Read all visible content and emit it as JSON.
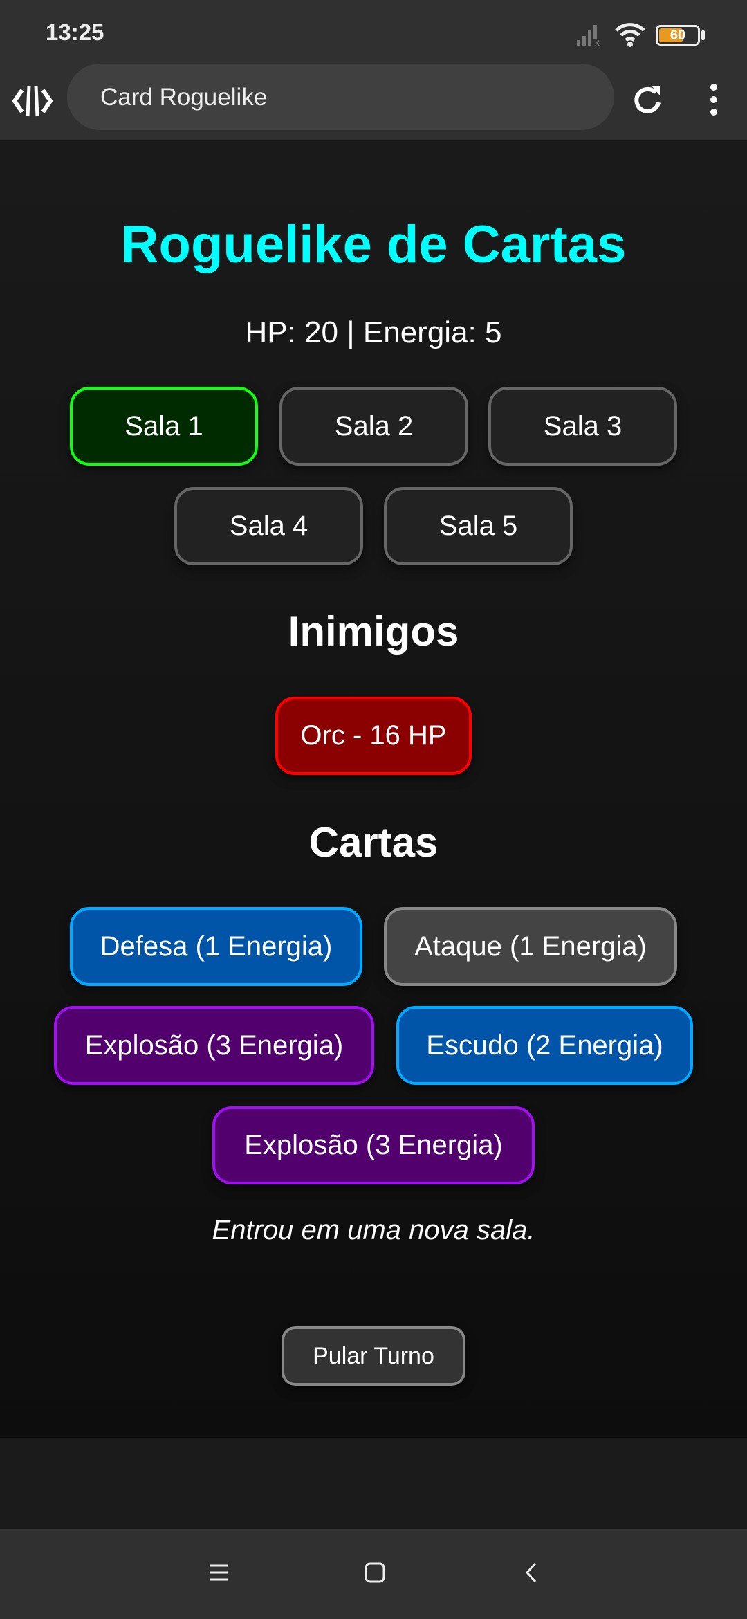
{
  "status_bar": {
    "time": "13:25",
    "battery": "60"
  },
  "browser": {
    "page_title": "Card Roguelike"
  },
  "game": {
    "title": "Roguelike de Cartas",
    "stats": "HP: 20 | Energia: 5",
    "rooms": [
      {
        "label": "Sala 1",
        "active": true
      },
      {
        "label": "Sala 2"
      },
      {
        "label": "Sala 3"
      },
      {
        "label": "Sala 4"
      },
      {
        "label": "Sala 5"
      }
    ],
    "enemies_heading": "Inimigos",
    "enemies": [
      {
        "label": "Orc - 16 HP"
      }
    ],
    "cards_heading": "Cartas",
    "cards": [
      {
        "label": "Defesa (1 Energia)",
        "type": "defense"
      },
      {
        "label": "Ataque (1 Energia)",
        "type": "attack"
      },
      {
        "label": "Explosão (3 Energia)",
        "type": "magic"
      },
      {
        "label": "Escudo (2 Energia)",
        "type": "defense"
      },
      {
        "label": "Explosão (3 Energia)",
        "type": "magic"
      }
    ],
    "message": "Entrou em uma nova sala.",
    "skip_button": "Pular Turno"
  },
  "colors": {
    "title": "#00ffff",
    "active_room_border": "#11ff11",
    "enemy_bg": "#8b0000",
    "defense_bg": "#0055a8",
    "attack_bg": "#444444",
    "magic_bg": "#52006e"
  }
}
